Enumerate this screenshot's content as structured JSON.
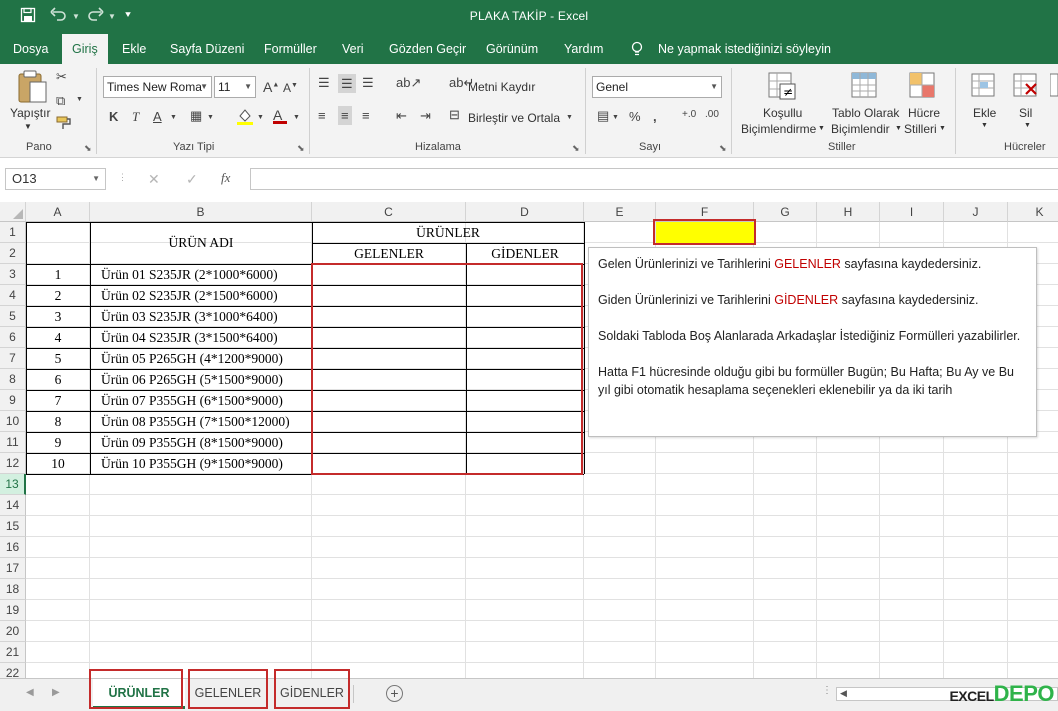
{
  "window": {
    "title": "PLAKA TAKİP  -  Excel",
    "quick_access": [
      "save-icon",
      "undo-icon",
      "redo-icon",
      "customize-icon"
    ]
  },
  "menu": {
    "tabs": [
      "Dosya",
      "Giriş",
      "Ekle",
      "Sayfa Düzeni",
      "Formüller",
      "Veri",
      "Gözden Geçir",
      "Görünüm",
      "Yardım"
    ],
    "active": "Giriş",
    "tell_me": "Ne yapmak istediğinizi söyleyin"
  },
  "ribbon": {
    "clipboard": {
      "paste_label": "Yapıştır",
      "group": "Pano"
    },
    "font": {
      "name": "Times New Roma",
      "size": "11",
      "bold": "K",
      "italic": "T",
      "underline": "A",
      "group": "Yazı Tipi"
    },
    "alignment": {
      "wrap": "Metni Kaydır",
      "merge": "Birleştir ve Ortala",
      "group": "Hizalama"
    },
    "number": {
      "format": "Genel",
      "group": "Sayı"
    },
    "styles": {
      "conditional_1": "Koşullu",
      "conditional_2": "Biçimlendirme",
      "table_1": "Tablo Olarak",
      "table_2": "Biçimlendir",
      "cell_1": "Hücre",
      "cell_2": "Stilleri",
      "group": "Stiller"
    },
    "cells": {
      "insert": "Ekle",
      "delete": "Sil",
      "group": "Hücreler"
    },
    "accent": "#217346"
  },
  "formula_bar": {
    "name_box": "O13",
    "fx": "fx",
    "value": ""
  },
  "grid": {
    "columns": [
      "A",
      "B",
      "C",
      "D",
      "E",
      "F",
      "G",
      "H",
      "I",
      "J",
      "K"
    ],
    "rows": [
      "1",
      "2",
      "3",
      "4",
      "5",
      "6",
      "7",
      "8",
      "9",
      "10",
      "11",
      "12",
      "13",
      "14",
      "15",
      "16",
      "17",
      "18",
      "19",
      "20",
      "21",
      "22"
    ],
    "selected_row": "13",
    "table": {
      "header_name": "ÜRÜN ADI",
      "header_group": "ÜRÜNLER",
      "header_in": "GELENLER",
      "header_out": "GİDENLER",
      "rows": [
        {
          "no": "1",
          "name": "Ürün 01 S235JR (2*1000*6000)"
        },
        {
          "no": "2",
          "name": "Ürün 02 S235JR (2*1500*6000)"
        },
        {
          "no": "3",
          "name": "Ürün 03 S235JR (3*1000*6400)"
        },
        {
          "no": "4",
          "name": "Ürün 04 S235JR (3*1500*6400)"
        },
        {
          "no": "5",
          "name": "Ürün 05 P265GH (4*1200*9000)"
        },
        {
          "no": "6",
          "name": "Ürün 06 P265GH (5*1500*9000)"
        },
        {
          "no": "7",
          "name": "Ürün 07 P355GH (6*1500*9000)"
        },
        {
          "no": "8",
          "name": "Ürün 08 P355GH (7*1500*12000)"
        },
        {
          "no": "9",
          "name": "Ürün 09 P355GH (8*1500*9000)"
        },
        {
          "no": "10",
          "name": "Ürün 10 P355GH (9*1500*9000)"
        }
      ]
    },
    "f1_fill": "#ffff00"
  },
  "note": {
    "p1_a": "Gelen Ürünlerinizi ve Tarihlerini ",
    "p1_b": "GELENLER",
    "p1_c": " sayfasına kaydedersiniz.",
    "p2_a": "Giden Ürünlerinizi ve Tarihlerini ",
    "p2_b": "GİDENLER",
    "p2_c": " sayfasına kaydedersiniz.",
    "p3": "Soldaki Tabloda Boş Alanlarada Arkadaşlar İstediğiniz Formülleri yazabilirler.",
    "p4": "Hatta F1 hücresinde olduğu gibi bu formüller Bugün; Bu Hafta; Bu Ay ve Bu yıl gibi otomatik hesaplama seçenekleri eklenebilir ya da iki tarih"
  },
  "sheets": {
    "tabs": [
      "ÜRÜNLER",
      "GELENLER",
      "GİDENLER"
    ],
    "active": "ÜRÜNLER"
  },
  "watermark": {
    "part1": "EXCEL",
    "part2": "DEPO"
  }
}
